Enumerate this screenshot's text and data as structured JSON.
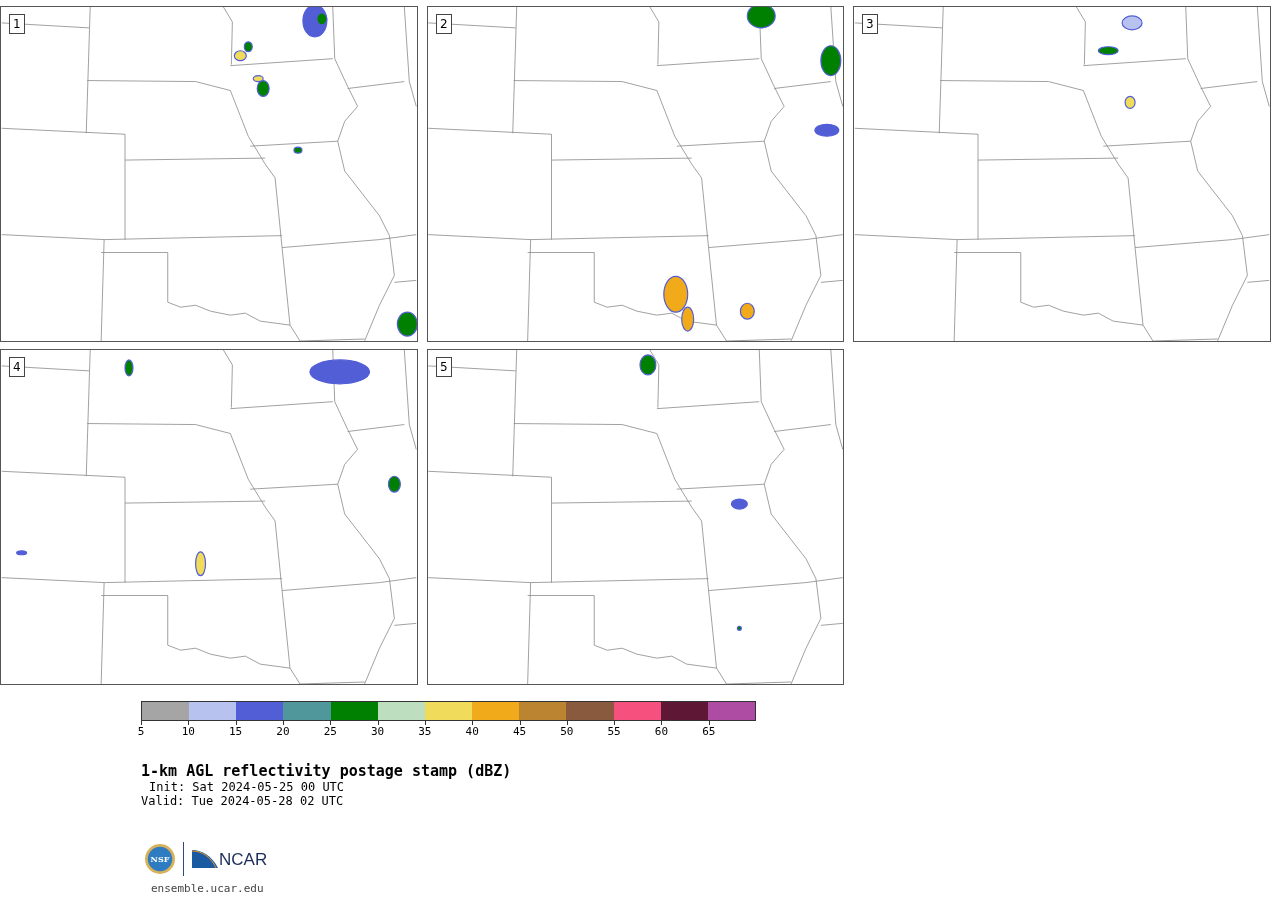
{
  "panels": [
    {
      "label": "1"
    },
    {
      "label": "2"
    },
    {
      "label": "3"
    },
    {
      "label": "4"
    },
    {
      "label": "5"
    }
  ],
  "colorbar": {
    "bins": [
      {
        "color": "#a5a5a5"
      },
      {
        "color": "#b7c3ee"
      },
      {
        "color": "#525ed6"
      },
      {
        "color": "#50979c"
      },
      {
        "color": "#008000"
      },
      {
        "color": "#bedfbf"
      },
      {
        "color": "#f0dc5a"
      },
      {
        "color": "#f0aa1a"
      },
      {
        "color": "#ba8430"
      },
      {
        "color": "#8a5a3e"
      },
      {
        "color": "#f5507e"
      },
      {
        "color": "#5e1836"
      },
      {
        "color": "#ae4ba2"
      }
    ],
    "ticks": [
      "5",
      "10",
      "15",
      "20",
      "25",
      "30",
      "35",
      "40",
      "45",
      "50",
      "55",
      "60",
      "65"
    ]
  },
  "title": "1-km AGL reflectivity postage stamp (dBZ)",
  "init": "Init: Sat 2024-05-25 00 UTC",
  "valid": "Valid: Tue 2024-05-28 02 UTC",
  "logo": {
    "nsf": "NSF",
    "ncar": "NCAR"
  },
  "link": "ensemble.ucar.edu"
}
